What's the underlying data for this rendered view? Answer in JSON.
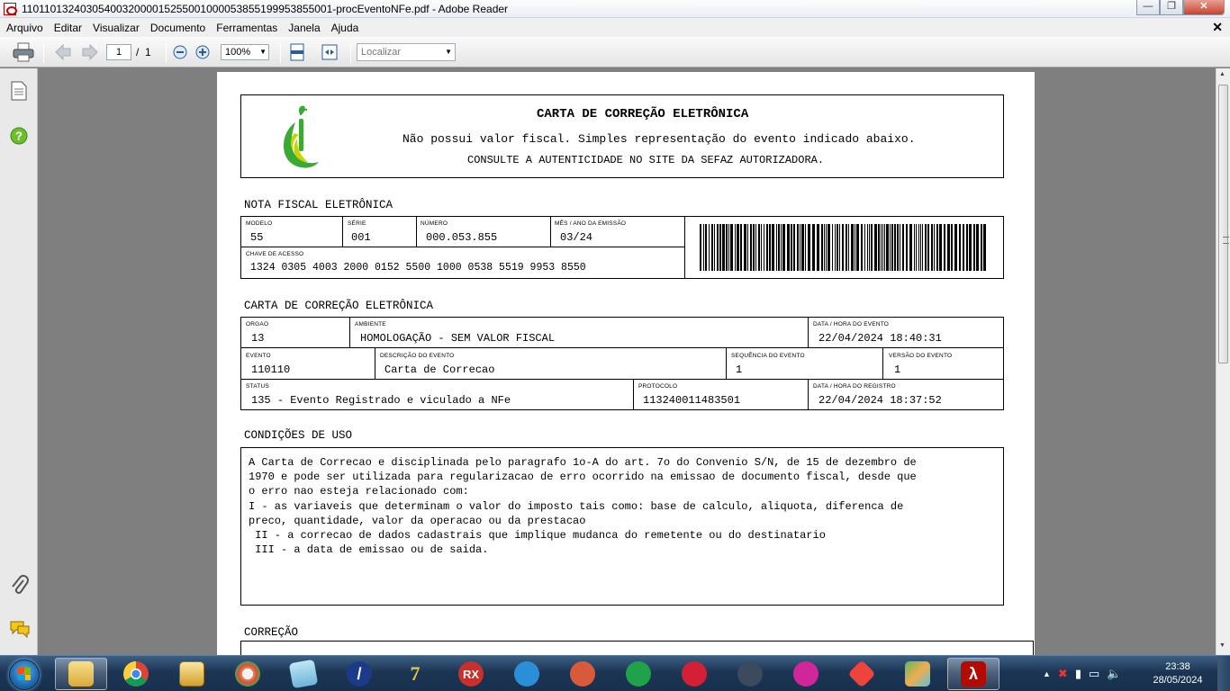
{
  "window": {
    "title": "11011013240305400320000152550010000538551999538550​01-procEventoNFe.pdf - Adobe Reader"
  },
  "menu": [
    "Arquivo",
    "Editar",
    "Visualizar",
    "Documento",
    "Ferramentas",
    "Janela",
    "Ajuda"
  ],
  "toolbar": {
    "page_current": "1",
    "page_sep": "/",
    "page_total": "1",
    "zoom": "100%",
    "find_placeholder": "Localizar"
  },
  "doc": {
    "header": {
      "title": "CARTA DE CORREÇÃO ELETRÔNICA",
      "line1": "Não possui valor fiscal. Simples representação do evento indicado abaixo.",
      "line2": "CONSULTE A AUTENTICIDADE NO SITE DA SEFAZ AUTORIZADORA."
    },
    "nfe": {
      "section": "NOTA FISCAL ELETRÔNICA",
      "modelo_label": "MODELO",
      "modelo": "55",
      "serie_label": "SÉRIE",
      "serie": "001",
      "numero_label": "NÚMERO",
      "numero": "000.053.855",
      "mes_label": "MÊS / ANO DA EMISSÃO",
      "mes": "03/24",
      "chave_label": "CHAVE DE ACESSO",
      "chave": "1324 0305 4003 2000 0152 5500 1000 0538 5519 9953 8550"
    },
    "cce": {
      "section": "CARTA DE CORREÇÃO ELETRÔNICA",
      "orgao_label": "ORGAO",
      "orgao": "13",
      "ambiente_label": "AMBIENTE",
      "ambiente": "HOMOLOGAÇÃO - SEM VALOR FISCAL",
      "datahora_evento_label": "DATA / HORA DO EVENTO",
      "datahora_evento": "22/04/2024 18:40:31",
      "evento_label": "EVENTO",
      "evento": "110110",
      "descricao_label": "DESCRIÇÃO DO EVENTO",
      "descricao": "Carta de Correcao",
      "sequencia_label": "SEQUÊNCIA DO EVENTO",
      "sequencia": "1",
      "versao_label": "VERSÃO DO EVENTO",
      "versao": "1",
      "status_label": "STATUS",
      "status": "135 - Evento Registrado e viculado a NFe",
      "protocolo_label": "PROTOCOLO",
      "protocolo": "113240011483501",
      "datahora_registro_label": "DATA / HORA DO REGISTRO",
      "datahora_registro": "22/04/2024 18:37:52"
    },
    "condicoes": {
      "section": "CONDIÇÕES DE USO",
      "text": "A Carta de Correcao e disciplinada pelo paragrafo 1o-A do art. 7o do Convenio S/N, de 15 de dezembro de\n1970 e pode ser utilizada para regularizacao de erro ocorrido na emissao de documento fiscal, desde que\no erro nao esteja relacionado com:\nI - as variaveis que determinam o valor do imposto tais como: base de calculo, aliquota, diferenca de\npreco, quantidade, valor da operacao ou da prestacao\n II - a correcao de dados cadastrais que implique mudanca do remetente ou do destinatario\n III - a data de emissao ou de saida."
    },
    "correcao": {
      "section": "CORREÇÃO"
    }
  },
  "taskbar": {
    "rx_label": "RX",
    "clock_time": "23:38",
    "clock_date": "28/05/2024"
  },
  "colors": {
    "taskbar": "#1c3554",
    "pdf_red": "#b30b00",
    "logo_green": "#3aaa35",
    "logo_yellow": "#c8d400"
  }
}
